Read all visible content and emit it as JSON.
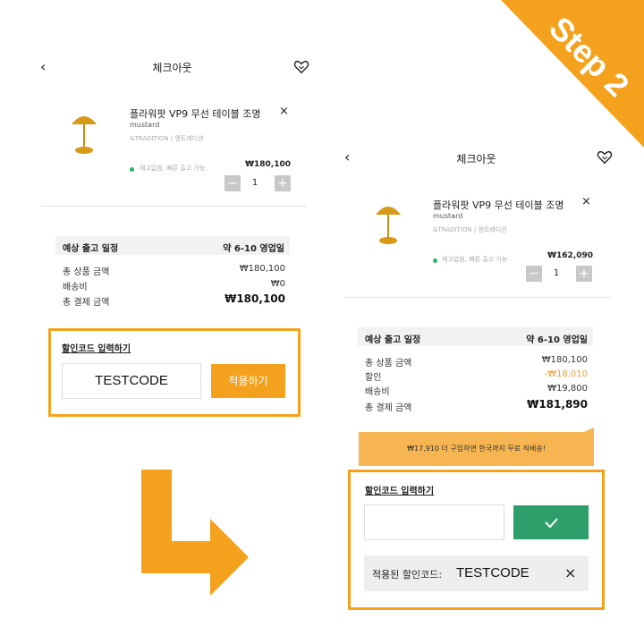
{
  "step_badge": "Step 2",
  "colors": {
    "accent": "#f4a21d",
    "success": "#2e9e6b",
    "discount": "#e8a03c",
    "stock_dot": "#2fb36a"
  },
  "before": {
    "header": {
      "title": "체크아웃",
      "back_icon": "chevron-left-icon",
      "wish_icon": "heart-icon"
    },
    "product": {
      "name": "플라워팟 VP9 무선 테이블 조명",
      "variant": "mustard",
      "brand": "&TRADITION | 앤트레디션",
      "stock_text": "재고없음, 빠른 출고 가능",
      "price": "₩180,100",
      "qty": "1",
      "minus": "−",
      "plus": "+",
      "remove": "×"
    },
    "summary": {
      "shipping_label": "예상 출고 일정",
      "shipping_value": "약 6-10 영업일",
      "rows": [
        {
          "label": "총 상품 금액",
          "value": "₩180,100"
        },
        {
          "label": "배송비",
          "value": "₩0"
        }
      ],
      "total_label": "총 결제 금액",
      "total_value": "₩180,100"
    },
    "coupon": {
      "title": "할인코드 입력하기",
      "input_value": "TESTCODE",
      "apply_label": "적용하기"
    }
  },
  "after": {
    "header": {
      "title": "체크아웃",
      "back_icon": "chevron-left-icon",
      "wish_icon": "heart-icon"
    },
    "product": {
      "name": "플라워팟 VP9 무선 테이블 조명",
      "variant": "mustard",
      "brand": "&TRADITION | 앤트레디션",
      "stock_text": "재고없음, 빠른 출고 가능",
      "price": "₩162,090",
      "qty": "1",
      "minus": "−",
      "plus": "+",
      "remove": "×"
    },
    "summary": {
      "shipping_label": "예상 출고 일정",
      "shipping_value": "약 6-10 영업일",
      "rows": [
        {
          "label": "총 상품 금액",
          "value": "₩180,100"
        },
        {
          "label": "할인",
          "value": "-₩18,010"
        },
        {
          "label": "배송비",
          "value": "₩19,800"
        }
      ],
      "total_label": "총 결제 금액",
      "total_value": "₩181,890"
    },
    "tooltip": "₩17,910 더 구입하면 한국까지 무료 직배송!",
    "coupon": {
      "title": "할인코드 입력하기",
      "input_value": "",
      "confirm_icon": "check-icon",
      "applied_label": "적용된 할인코드:",
      "applied_code": "TESTCODE",
      "remove": "×"
    }
  }
}
